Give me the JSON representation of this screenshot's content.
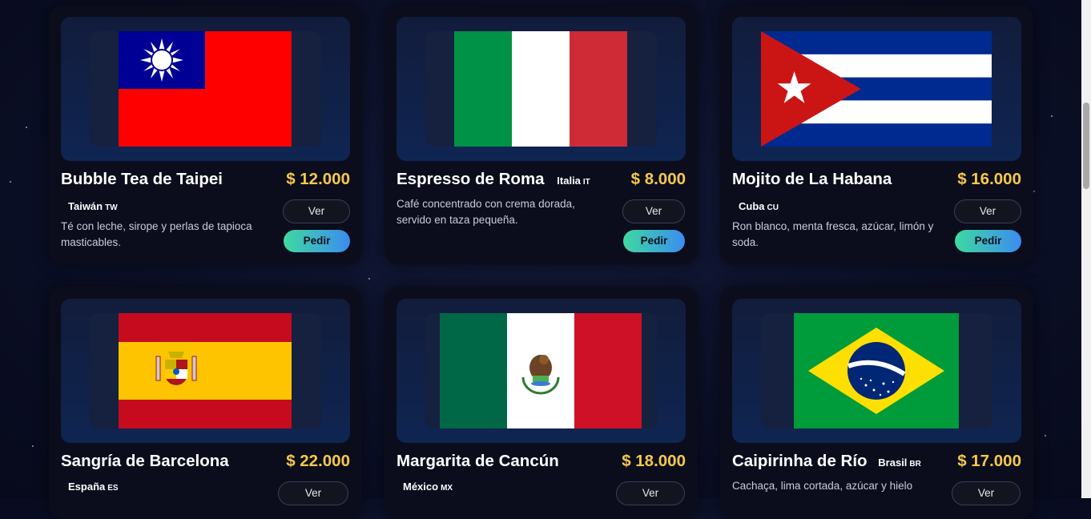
{
  "colors": {
    "price": "#f7c948",
    "pedir_start": "#3fd9a0",
    "pedir_end": "#3b8cf0"
  },
  "cards": [
    {
      "title": "Bubble Tea de Taipei",
      "country": "Taiwán",
      "country_code": "TW",
      "price": "$ 12.000",
      "desc": "Té con leche, sirope y perlas de tapioca masticables.",
      "btn_ver": "Ver",
      "btn_pedir": "Pedir",
      "flag": "taiwan-flag"
    },
    {
      "title": "Espresso de Roma",
      "country": "Italia",
      "country_code": "IT",
      "price": "$ 8.000",
      "desc": "Café concentrado con crema dorada, servido en taza pequeña.",
      "btn_ver": "Ver",
      "btn_pedir": "Pedir",
      "flag": "italy-flag"
    },
    {
      "title": "Mojito de La Habana",
      "country": "Cuba",
      "country_code": "CU",
      "price": "$ 16.000",
      "desc": "Ron blanco, menta fresca, azúcar, limón y soda.",
      "btn_ver": "Ver",
      "btn_pedir": "Pedir",
      "flag": "cuba-flag"
    },
    {
      "title": "Sangría de Barcelona",
      "country": "España",
      "country_code": "ES",
      "price": "$ 22.000",
      "desc": "",
      "btn_ver": "Ver",
      "flag": "spain-flag"
    },
    {
      "title": "Margarita de Cancún",
      "country": "México",
      "country_code": "MX",
      "price": "$ 18.000",
      "desc": "",
      "btn_ver": "Ver",
      "flag": "mexico-flag"
    },
    {
      "title": "Caipirinha de Río",
      "country": "Brasil",
      "country_code": "BR",
      "price": "$ 17.000",
      "desc": "Cachaça, lima cortada, azúcar y hielo",
      "btn_ver": "Ver",
      "flag": "brazil-flag"
    }
  ]
}
